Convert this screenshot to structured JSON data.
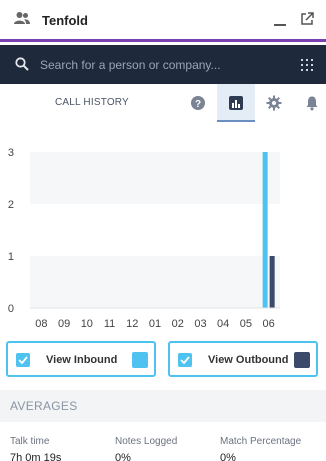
{
  "window": {
    "title": "Tenfold"
  },
  "search": {
    "placeholder": "Search for a person or company..."
  },
  "tabs": {
    "section_label": "CALL HISTORY"
  },
  "chart_data": {
    "type": "bar",
    "categories": [
      "08",
      "09",
      "10",
      "11",
      "12",
      "01",
      "02",
      "03",
      "04",
      "05",
      "06"
    ],
    "series": [
      {
        "name": "View Inbound",
        "color": "#4ec3f0",
        "values": [
          0,
          0,
          0,
          0,
          0,
          0,
          0,
          0,
          0,
          0,
          3
        ]
      },
      {
        "name": "View Outbound",
        "color": "#3b4a6b",
        "values": [
          0,
          0,
          0,
          0,
          0,
          0,
          0,
          0,
          0,
          0,
          1
        ]
      }
    ],
    "yticks": [
      0,
      1,
      2,
      3
    ],
    "ylim": [
      0,
      3
    ]
  },
  "toggles": {
    "inbound_label": "View Inbound",
    "outbound_label": "View Outbound"
  },
  "averages": {
    "heading": "AVERAGES",
    "stats": [
      {
        "label": "Talk time",
        "value": "7h 0m 19s"
      },
      {
        "label": "Notes Logged",
        "value": "0%"
      },
      {
        "label": "Match Percentage",
        "value": "0%"
      }
    ]
  },
  "colors": {
    "accent": "#7a3fb0",
    "inbound": "#4ec3f0",
    "outbound": "#3b4a6b",
    "header": "#1e2a3b"
  }
}
